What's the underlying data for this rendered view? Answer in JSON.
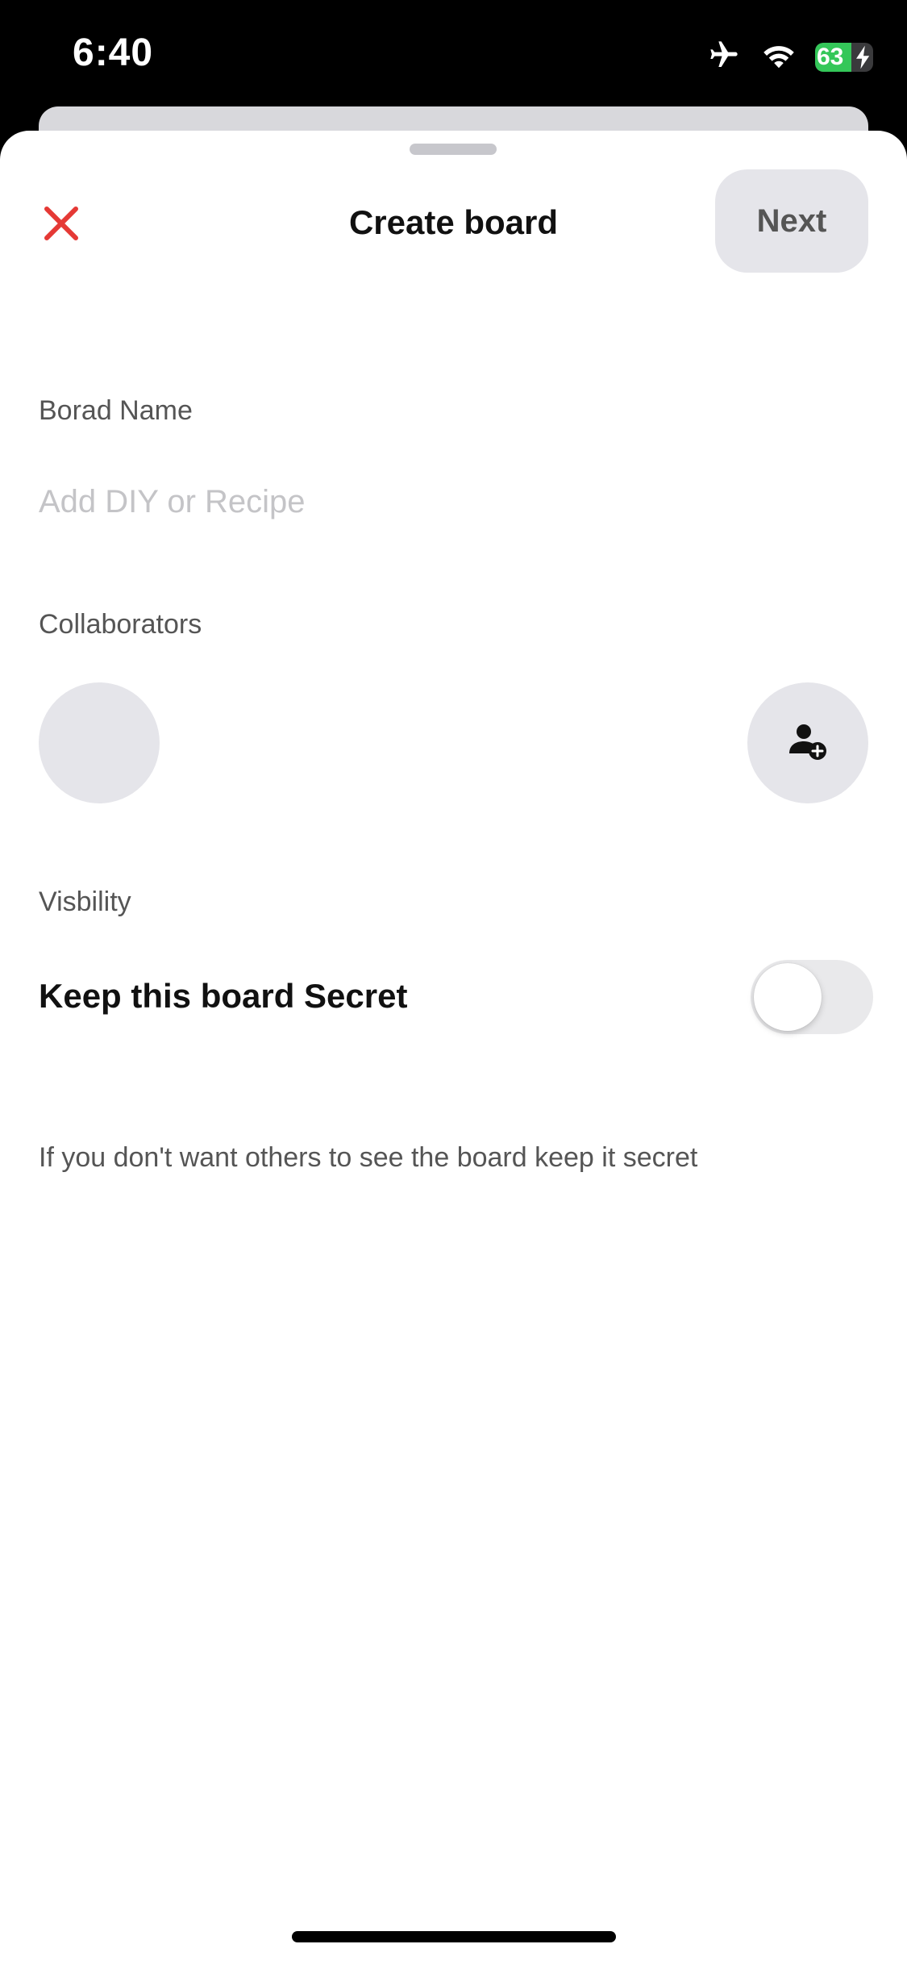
{
  "status_bar": {
    "time": "6:40",
    "battery_level": "63",
    "battery_fraction": 0.63,
    "icons": [
      "airplane-icon",
      "wifi-icon",
      "battery-icon",
      "charging-bolt-icon"
    ]
  },
  "sheet": {
    "title": "Create board",
    "close_icon": "close-icon",
    "next_label": "Next"
  },
  "board_name": {
    "label": "Borad Name",
    "value": "",
    "placeholder": "Add DIY or Recipe"
  },
  "collaborators": {
    "label": "Collaborators",
    "add_icon": "add-person-icon"
  },
  "visibility": {
    "label": "Visbility",
    "toggle_label": "Keep this board Secret",
    "toggle_on": false,
    "help_text": "If you don't want others to see the board keep it secret"
  },
  "colors": {
    "close_red": "#e53935",
    "battery_green": "#34c759",
    "button_gray": "#e5e5ea"
  }
}
